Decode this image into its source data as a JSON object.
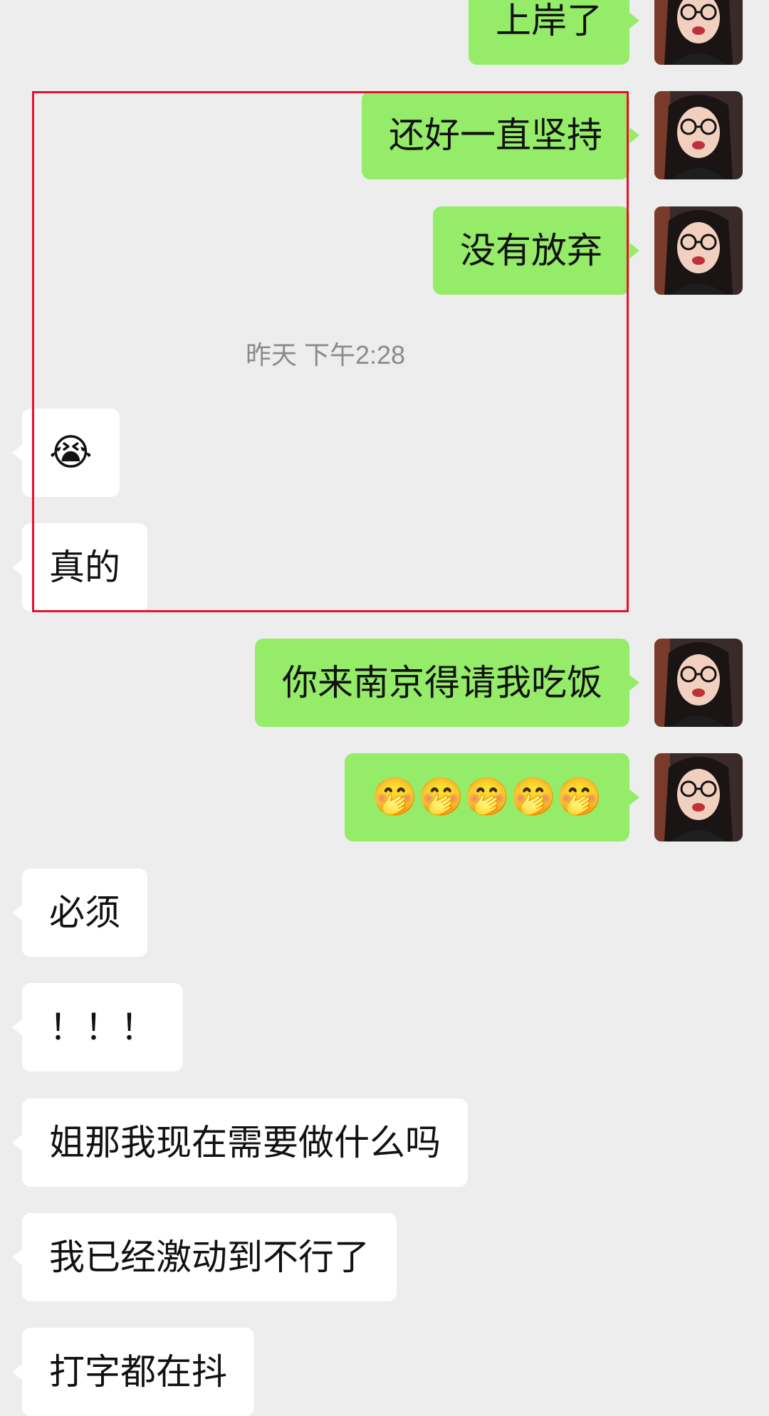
{
  "timestamp": "昨天 下午2:28",
  "messages": [
    {
      "side": "out",
      "text": "上岸了"
    },
    {
      "side": "out",
      "text": "还好一直坚持"
    },
    {
      "side": "out",
      "text": "没有放弃"
    },
    {
      "side": "in",
      "text": "😭"
    },
    {
      "side": "in",
      "text": "真的"
    },
    {
      "side": "out",
      "text": "你来南京得请我吃饭"
    },
    {
      "side": "out",
      "text": "🤭🤭🤭🤭🤭"
    },
    {
      "side": "in",
      "text": "必须"
    },
    {
      "side": "in",
      "text": "！！！"
    },
    {
      "side": "in",
      "text": "姐那我现在需要做什么吗"
    },
    {
      "side": "in",
      "text": "我已经激动到不行了"
    },
    {
      "side": "in",
      "text": "打字都在抖"
    }
  ],
  "colors": {
    "background": "#ededed",
    "outgoing_bubble": "#95ec69",
    "incoming_bubble": "#ffffff",
    "highlight_border": "#e8102e",
    "timestamp_text": "#8a8a8a"
  },
  "icons": {
    "avatar": "user-avatar"
  }
}
